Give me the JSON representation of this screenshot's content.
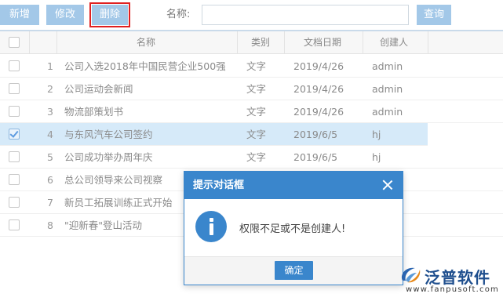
{
  "toolbar": {
    "buttons": [
      {
        "label": "新增"
      },
      {
        "label": "修改"
      },
      {
        "label": "删除"
      }
    ],
    "name_label": "名称:",
    "name_value": "",
    "search_label": "查询"
  },
  "table": {
    "columns": [
      "",
      "",
      "名称",
      "类别",
      "文档日期",
      "创建人"
    ],
    "rows": [
      {
        "num": "1",
        "name": "公司入选2018年中国民营企业500强",
        "category": "文字",
        "date": "2019/4/26",
        "creator": "admin",
        "checked": false
      },
      {
        "num": "2",
        "name": "公司运动会新闻",
        "category": "文字",
        "date": "2019/4/26",
        "creator": "admin",
        "checked": false
      },
      {
        "num": "3",
        "name": "物流部策划书",
        "category": "文字",
        "date": "2019/4/26",
        "creator": "admin",
        "checked": false
      },
      {
        "num": "4",
        "name": "与东风汽车公司签约",
        "category": "文字",
        "date": "2019/6/5",
        "creator": "hj",
        "checked": true
      },
      {
        "num": "5",
        "name": "公司成功举办周年庆",
        "category": "文字",
        "date": "2019/6/5",
        "creator": "hj",
        "checked": false
      },
      {
        "num": "6",
        "name": "总公司领导来公司视察",
        "category": "",
        "date": "",
        "creator": "",
        "checked": false
      },
      {
        "num": "7",
        "name": "新员工拓展训练正式开始",
        "category": "",
        "date": "",
        "creator": "",
        "checked": false
      },
      {
        "num": "8",
        "name": "\"迎新春\"登山活动",
        "category": "",
        "date": "",
        "creator": "",
        "checked": false
      }
    ]
  },
  "dialog": {
    "title": "提示对话框",
    "message": "权限不足或不是创建人!",
    "ok_label": "确定"
  },
  "watermark": {
    "brand": "泛普软件",
    "url": "www.fanpusoft.com"
  },
  "colors": {
    "primary": "#3a86cc",
    "toolbar_button": "#a3c8e8",
    "selected_row": "#d6eaf9",
    "highlight_outline": "#e02020"
  }
}
